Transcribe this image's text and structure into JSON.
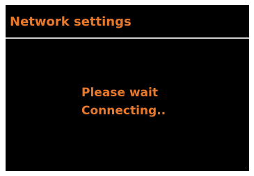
{
  "header": {
    "title": "Network settings"
  },
  "status": {
    "line1": "Please wait",
    "line2": "Connecting.."
  },
  "colors": {
    "background": "#000000",
    "accent_text": "#e8782c",
    "divider": "#cfcfcf",
    "frame": "#ffffff"
  }
}
